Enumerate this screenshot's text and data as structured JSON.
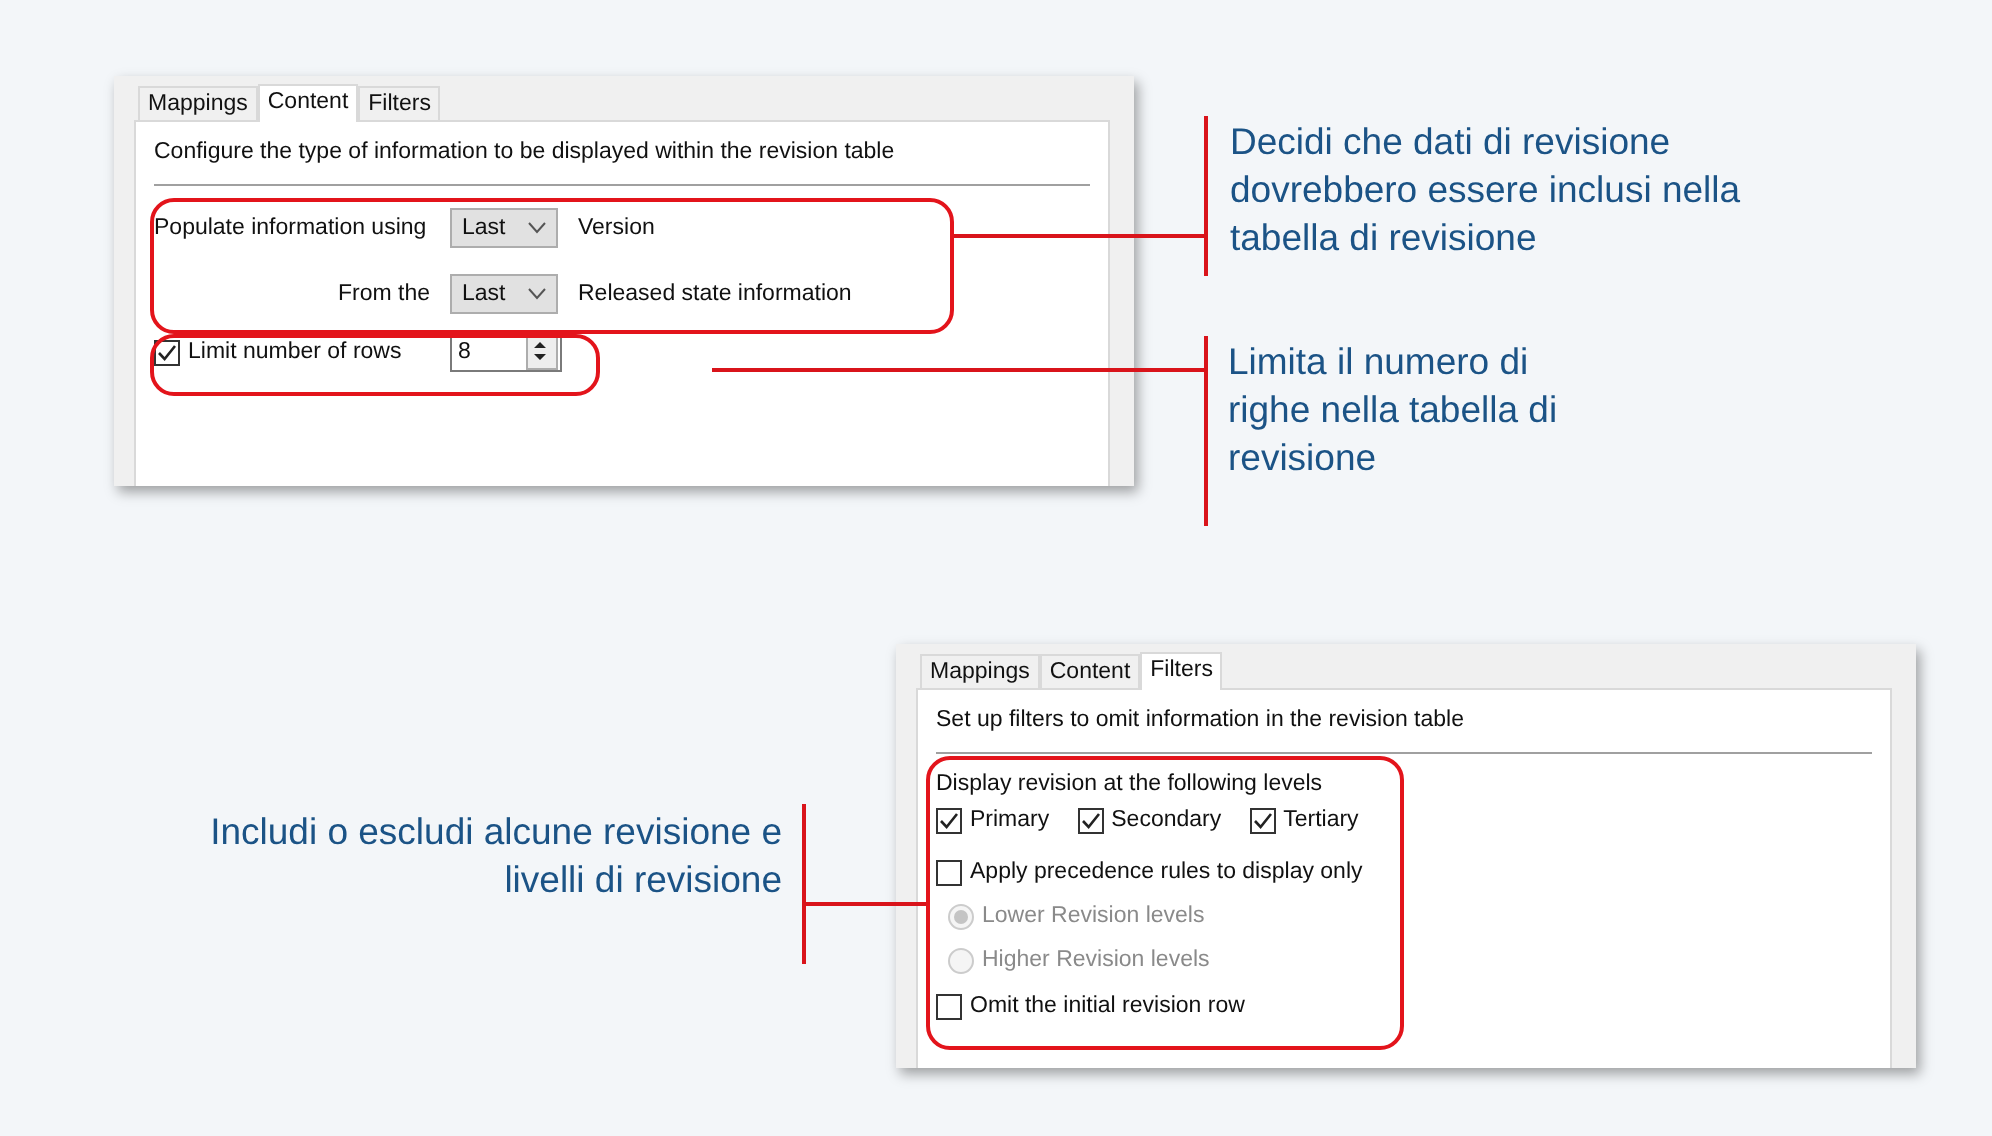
{
  "content_panel": {
    "tabs": [
      {
        "label": "Mappings",
        "selected": false
      },
      {
        "label": "Content",
        "selected": true
      },
      {
        "label": "Filters",
        "selected": false
      }
    ],
    "description": "Configure the type of information to be displayed within the revision table",
    "populate": {
      "label": "Populate information using",
      "value": "Last",
      "suffix": "Version"
    },
    "from": {
      "label": "From the",
      "value": "Last",
      "suffix": "Released state information"
    },
    "limit": {
      "label": "Limit number of rows",
      "checked": true,
      "value": "8"
    }
  },
  "filters_panel": {
    "tabs": [
      {
        "label": "Mappings",
        "selected": false
      },
      {
        "label": "Content",
        "selected": false
      },
      {
        "label": "Filters",
        "selected": true
      }
    ],
    "description": "Set up filters to omit information in the revision table",
    "levels_label": "Display revision at the following levels",
    "levels": [
      {
        "label": "Primary",
        "checked": true
      },
      {
        "label": "Secondary",
        "checked": true
      },
      {
        "label": "Tertiary",
        "checked": true
      }
    ],
    "precedence": {
      "label": "Apply precedence rules to display only",
      "checked": false
    },
    "radios": [
      {
        "label": "Lower Revision levels",
        "selected": true,
        "disabled": true
      },
      {
        "label": "Higher Revision levels",
        "selected": false,
        "disabled": true
      }
    ],
    "omit": {
      "label": "Omit the initial revision row",
      "checked": false
    }
  },
  "callouts": [
    {
      "text": "Decidi che dati di revisione dovrebbero essere inclusi nella tabella di revisione"
    },
    {
      "text": "Limita il numero di righe nella tabella di revisione"
    },
    {
      "text": "Includi o escludi alcune revisione e livelli di revisione"
    }
  ]
}
